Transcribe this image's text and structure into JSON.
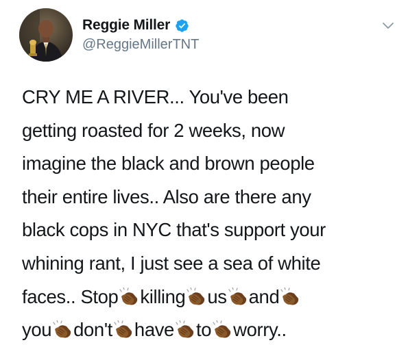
{
  "author": {
    "display_name": "Reggie Miller",
    "handle": "@ReggieMillerTNT",
    "verified": true,
    "avatar_icon": "profile-photo",
    "verified_icon": "verified-badge-icon",
    "verified_color": "#1da1f2"
  },
  "menu": {
    "icon": "chevron-down-icon"
  },
  "tweet": {
    "lines": [
      {
        "segments": [
          "CRY ME A RIVER... You've been"
        ]
      },
      {
        "segments": [
          "getting roasted for 2 weeks, now"
        ]
      },
      {
        "segments": [
          "imagine the black and brown people"
        ]
      },
      {
        "segments": [
          "their entire lives.. Also are there any"
        ]
      },
      {
        "segments": [
          "black cops in NYC that's support your"
        ]
      },
      {
        "segments": [
          "whining rant, I just see a sea of white"
        ]
      },
      {
        "segments": [
          "faces.. Stop",
          "killing",
          "us",
          "and",
          ""
        ]
      },
      {
        "segments": [
          "you",
          "don't",
          "have",
          "to",
          "worry.."
        ]
      }
    ],
    "emoji_icon": "clapping-hands-emoji",
    "text_color": "#14171a",
    "secondary_color": "#657786"
  }
}
